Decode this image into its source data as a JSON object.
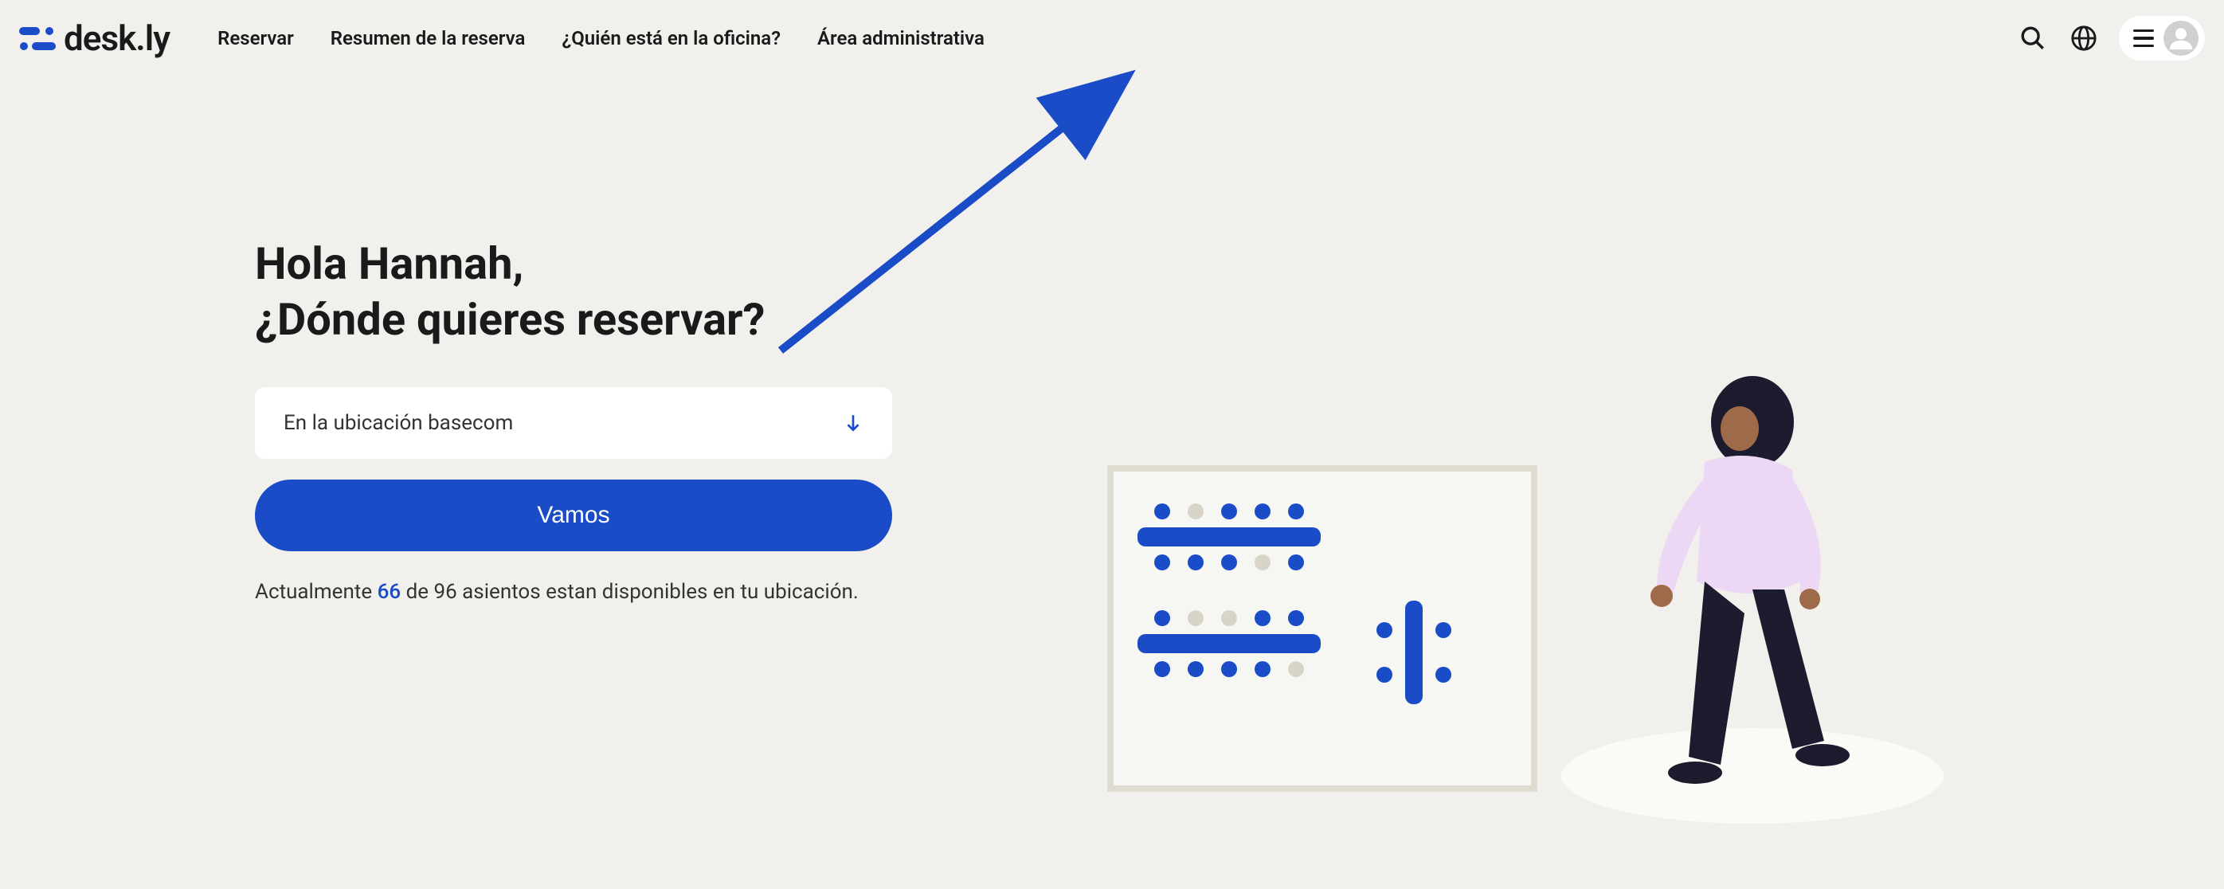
{
  "brand": {
    "name": "desk.ly"
  },
  "nav": {
    "items": [
      {
        "label": "Reservar"
      },
      {
        "label": "Resumen de la reserva"
      },
      {
        "label": "¿Quién está en la oficina?"
      },
      {
        "label": "Área administrativa"
      }
    ]
  },
  "main": {
    "greeting_line1": "Hola Hannah,",
    "greeting_line2": "¿Dónde quieres reservar?",
    "location_label": "En la ubicación basecom",
    "go_button": "Vamos",
    "availability_prefix": "Actualmente ",
    "availability_count": "66",
    "availability_suffix": " de 96 asientos estan disponibles en tu ubicación."
  },
  "colors": {
    "accent": "#1a4cc7",
    "bg": "#f1f0ec"
  }
}
